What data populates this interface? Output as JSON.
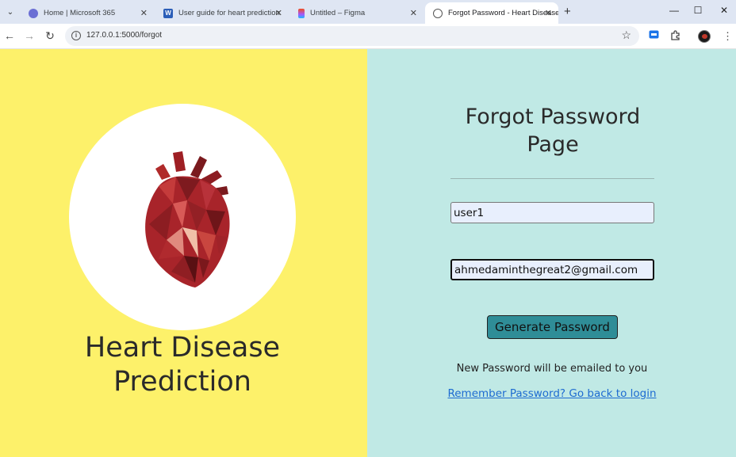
{
  "browser": {
    "tabs": [
      {
        "title": "Home | Microsoft 365"
      },
      {
        "title": "User guide for heart prediction"
      },
      {
        "title": "Untitled – Figma"
      },
      {
        "title": "Forgot Password - Heart Disease Prediction"
      }
    ],
    "new_tab_label": "+",
    "url": "127.0.0.1:5000/forgot"
  },
  "brand": {
    "line1": "Heart Disease",
    "line2": "Prediction"
  },
  "form": {
    "heading_line1": "Forgot Password",
    "heading_line2": "Page",
    "username_value": "user1",
    "email_value": "ahmedaminthegreat2@gmail.com",
    "submit_label": "Generate Password",
    "note": "New Password will be emailed to you",
    "back_link": "Remember Password? Go back to login"
  },
  "colors": {
    "left_panel": "#fdf16a",
    "right_panel": "#c0e9e5",
    "button": "#2f8d97",
    "link": "#1d6bd1"
  }
}
